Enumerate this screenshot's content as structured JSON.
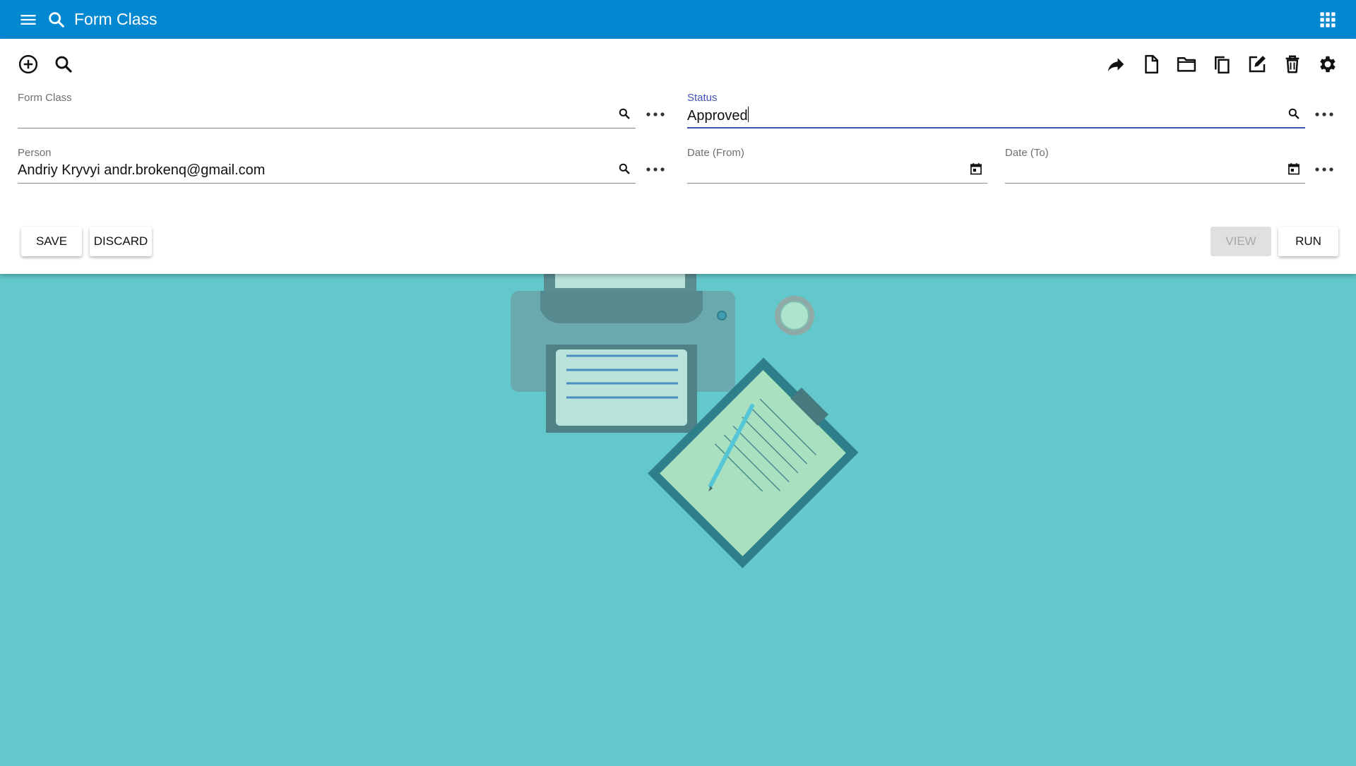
{
  "appbar": {
    "title": "Form Class",
    "menu_icon": "menu-icon",
    "search_icon": "search-icon",
    "apps_icon": "apps-grid-icon"
  },
  "toolbar": {
    "left_icons": [
      "add-circle-icon",
      "search-icon"
    ],
    "right_icons": [
      "share-icon",
      "new-document-icon",
      "open-folder-icon",
      "copy-icon",
      "edit-icon",
      "delete-icon",
      "settings-icon"
    ]
  },
  "form": {
    "form_class": {
      "label": "Form Class",
      "value": ""
    },
    "status": {
      "label": "Status",
      "value": "Approved"
    },
    "person": {
      "label": "Person",
      "value": "Andriy Kryvyi andr.brokenq@gmail.com"
    },
    "date_from": {
      "label": "Date (From)",
      "value": ""
    },
    "date_to": {
      "label": "Date (To)",
      "value": ""
    }
  },
  "actions": {
    "save": "SAVE",
    "discard": "DISCARD",
    "view": "VIEW",
    "run": "RUN"
  },
  "colors": {
    "appbar": "#0288d1",
    "background": "#63c8cc",
    "accent": "#3f51b5"
  }
}
